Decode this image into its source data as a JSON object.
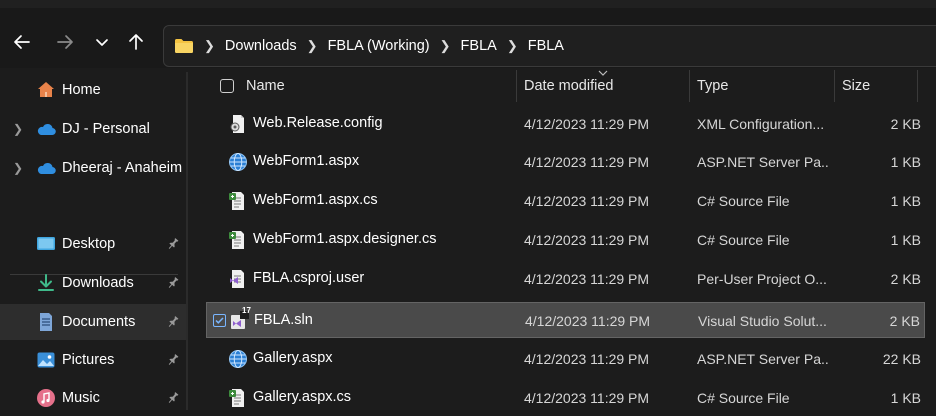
{
  "address": {
    "crumbs": [
      "Downloads",
      "FBLA (Working)",
      "FBLA",
      "FBLA"
    ]
  },
  "sidebar": {
    "items": [
      {
        "label": "Home",
        "icon": "home-icon"
      },
      {
        "label": "DJ - Personal",
        "icon": "onedrive-cloud-icon"
      },
      {
        "label": "Dheeraj - Anaheim",
        "icon": "onedrive-cloud-icon"
      },
      {
        "label": "Desktop",
        "icon": "desktop-icon"
      },
      {
        "label": "Downloads",
        "icon": "download-icon"
      },
      {
        "label": "Documents",
        "icon": "documents-icon"
      },
      {
        "label": "Pictures",
        "icon": "pictures-icon"
      },
      {
        "label": "Music",
        "icon": "music-icon"
      }
    ]
  },
  "columns": {
    "name": "Name",
    "date": "Date modified",
    "type": "Type",
    "size": "Size"
  },
  "files": [
    {
      "name": "Web.Release.config",
      "date": "4/12/2023 11:29 PM",
      "type": "XML Configuration...",
      "size": "2 KB",
      "icon": "config-file-icon"
    },
    {
      "name": "WebForm1.aspx",
      "date": "4/12/2023 11:29 PM",
      "type": "ASP.NET Server Pa...",
      "size": "1 KB",
      "icon": "aspx-globe-icon"
    },
    {
      "name": "WebForm1.aspx.cs",
      "date": "4/12/2023 11:29 PM",
      "type": "C# Source File",
      "size": "1 KB",
      "icon": "csharp-file-icon"
    },
    {
      "name": "WebForm1.aspx.designer.cs",
      "date": "4/12/2023 11:29 PM",
      "type": "C# Source File",
      "size": "1 KB",
      "icon": "csharp-file-icon"
    },
    {
      "name": "FBLA.csproj.user",
      "date": "4/12/2023 11:29 PM",
      "type": "Per-User Project O...",
      "size": "2 KB",
      "icon": "vs-project-file-icon"
    },
    {
      "name": "FBLA.sln",
      "date": "4/12/2023 11:29 PM",
      "type": "Visual Studio Solut...",
      "size": "2 KB",
      "icon": "vs-solution-icon",
      "vs_version": "17"
    },
    {
      "name": "Gallery.aspx",
      "date": "4/12/2023 11:29 PM",
      "type": "ASP.NET Server Pa...",
      "size": "22 KB",
      "icon": "aspx-globe-icon"
    },
    {
      "name": "Gallery.aspx.cs",
      "date": "4/12/2023 11:29 PM",
      "type": "C# Source File",
      "size": "1 KB",
      "icon": "csharp-file-icon"
    }
  ],
  "colors": {
    "background": "#1c1c1c",
    "selected_row": "#4a4a4a",
    "folder": "#f4c342",
    "onedrive": "#2f8ee0",
    "accent": "#7ab6ff"
  }
}
